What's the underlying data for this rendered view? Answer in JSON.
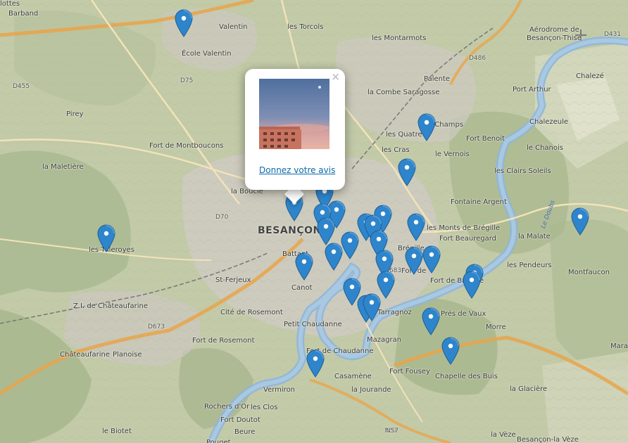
{
  "map": {
    "city_label": "BESANÇON",
    "places": [
      "lottes",
      "Barband",
      "Valentin",
      "les Torcols",
      "École Valentin",
      "les Montarmots",
      "Aérodrome de",
      "Besançon-Thise",
      "Palente",
      "Port Arthur",
      "Chalezé",
      "la Combe Saragosse",
      "Pirey",
      "les Champs",
      "Fort Benoit",
      "Chalezeule",
      "les Quatre",
      "le Vernois",
      "le Chanois",
      "Fort de Montboucons",
      "les Cras",
      "la Maletière",
      "les Clairs Soleils",
      "la Boucle",
      "Fontaine Argent",
      "les Tilleroyes",
      "les Monts de Brégille",
      "Fort Beauregard",
      "Battant",
      "Brégille",
      "la Malate",
      "St-Ferjeux",
      "Canot",
      "les Pendeurs",
      "Montfaucon",
      "Fort de Bregille",
      "Z.I. de Châteaufarine",
      "Cité de Rosemont",
      "Tarragnoz",
      "Prés de Vaux",
      "Petit Chaudanne",
      "Morre",
      "Châteaufarine",
      "Planoise",
      "Fort de Rosemont",
      "Mazagran",
      "Fort de Chaudanne",
      "Casamène",
      "Fort Fousey",
      "Chapelle des Buis",
      "Mara",
      "Vermiron",
      "la Jourande",
      "la Glacière",
      "Rochers d'Or",
      "les Clos",
      "Fort Doutot",
      "le Biotet",
      "Beure",
      "la Vèze",
      "Besançon-la Vèze",
      "Pouget",
      "Fort de"
    ],
    "road_labels": [
      "D75",
      "D455",
      "D70",
      "N57",
      "D673",
      "D683",
      "D486",
      "D431",
      "D683",
      "N57"
    ],
    "river_label": "Le Doubs",
    "marker_count": 33
  },
  "popup": {
    "close_label": "×",
    "link_label": "Donnez votre avis"
  },
  "colors": {
    "marker_fill": "#2e85cb",
    "marker_stroke": "#1d5f95",
    "river": "#8fb6d9",
    "major_road": "#e8a54a",
    "link": "#0a6aa8"
  }
}
